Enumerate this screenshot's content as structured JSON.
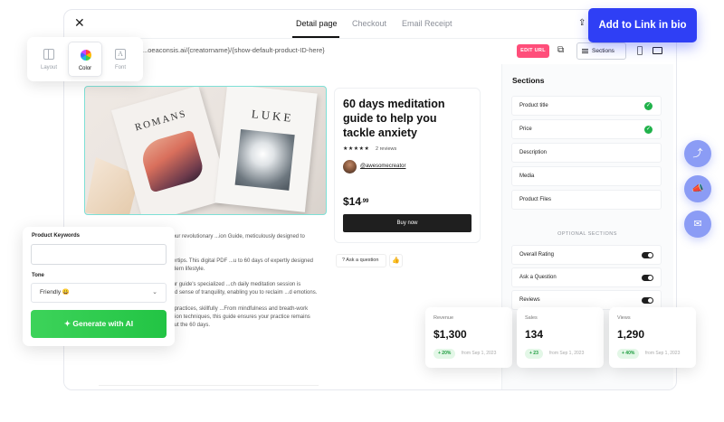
{
  "tabs": [
    {
      "label": "Detail page",
      "active": true
    },
    {
      "label": "Checkout",
      "active": false
    },
    {
      "label": "Email Receipt",
      "active": false
    }
  ],
  "url": {
    "text": "...oeaconsis.ai/{creatorname}/{show-default-product-ID-here}",
    "edit_label": "EDIT URL"
  },
  "toolbar": {
    "sections_label": "Sections"
  },
  "cta": {
    "link_in_bio": "Add to Link in bio"
  },
  "style_options": [
    {
      "label": "Layout",
      "icon": "layout-icon",
      "selected": false
    },
    {
      "label": "Color",
      "icon": "color-wheel-icon",
      "selected": true
    },
    {
      "label": "Font",
      "icon": "font-icon",
      "selected": false
    }
  ],
  "product": {
    "title": "60 days meditation guide to help you tackle anxiety",
    "stars": "★★★★★",
    "reviews": "2 reviews",
    "creator": "@awesomecreator",
    "price_main": "$14",
    "price_cents": ".99",
    "buy_label": "Buy now",
    "ask_label": "Ask a question",
    "book_titles": [
      "ROMANS",
      "LUKE"
    ]
  },
  "description": [
    "...ntrol of your inner peace with our revolutionary ...ion Guide, meticulously designed to empower you in ...anxiety.",
    "...ive transformation at your fingertips. This digital PDF ...u to 60 days of expertly designed meditation ...lessly into your modern lifestyle.",
    "Address anxiety head-on with our guide's specialized ...ch daily meditation session is thoughtfully curated to ...profound sense of tranquility, enabling you to reclaim ...d emotions.",
    "...e into a plethora of meditation practices, skillfully ...From mindfulness and breath-work exercises to advanced visualization techniques, this guide ensures your practice remains engaging and effective throughout the 60 days."
  ],
  "sections_panel": {
    "title": "Sections",
    "required": [
      {
        "label": "Product title",
        "checked": true
      },
      {
        "label": "Price",
        "checked": true
      },
      {
        "label": "Description",
        "checked": false
      },
      {
        "label": "Media",
        "checked": false
      },
      {
        "label": "Product Files",
        "checked": false
      }
    ],
    "optional_title": "OPTIONAL SECTIONS",
    "optional": [
      {
        "label": "Overall Rating",
        "on": true
      },
      {
        "label": "Ask a Question",
        "on": true
      },
      {
        "label": "Reviews",
        "on": true
      }
    ]
  },
  "ai_panel": {
    "keywords_label": "Product Keywords",
    "keywords_value": "",
    "tone_label": "Tone",
    "tone_value": "Friendly 😀",
    "generate_label": "Generate with AI"
  },
  "stats": [
    {
      "label": "Revenue",
      "value": "$1,300",
      "change": "+ 20%",
      "from": "from Sep 1, 2023"
    },
    {
      "label": "Sales",
      "value": "134",
      "change": "+ 23",
      "from": "from Sep 1, 2023"
    },
    {
      "label": "Views",
      "value": "1,290",
      "change": "+ 40%",
      "from": "from Sep 1, 2023"
    }
  ],
  "colors": {
    "primary": "#2f3ff5",
    "edit_pill": "#ff4e7a",
    "success": "#21b24b",
    "ai_green": "#22c444",
    "side_buttons": "#8b9cf5"
  },
  "side_actions": [
    {
      "icon": "share-icon"
    },
    {
      "icon": "megaphone-icon"
    },
    {
      "icon": "mail-icon"
    }
  ]
}
